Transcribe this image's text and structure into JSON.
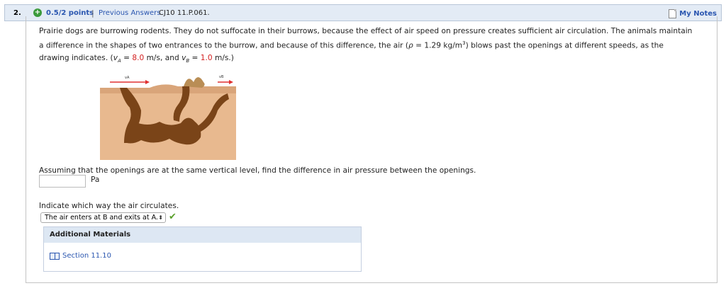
{
  "header": {
    "question_number": "2.",
    "points": "0.5/2 points",
    "separator": "|",
    "previous_answers": "Previous Answers",
    "question_id": "CJ10 11.P.061.",
    "my_notes": "My Notes"
  },
  "problem": {
    "p1_line1": "Prairie dogs are burrowing rodents. They do not suffocate in their burrows, because the effect of air speed on pressure creates sufficient air circulation. The animals maintain",
    "p1_line2a": "a difference in the shapes of two entrances to the burrow, and because of this difference, the air (",
    "rho": "ρ",
    "p1_line2b": " = 1.29 kg/m",
    "sup3": "3",
    "p1_line2c": ") blows past the openings at different speeds, as the",
    "p1_line3a": "drawing indicates. (",
    "va_label": "v",
    "va_sub": "A",
    "eq1": " = ",
    "va_value": "8.0",
    "va_unit": " m/s, and ",
    "vb_label": "v",
    "vb_sub": "B",
    "eq2": " = ",
    "vb_value": "1.0",
    "vb_unit": " m/s.)"
  },
  "figure": {
    "label_a": "vA",
    "label_b": "vB"
  },
  "part1": {
    "question": "Assuming that the openings are at the same vertical level, find the difference in air pressure between the openings.",
    "input_value": "",
    "unit": "Pa"
  },
  "part2": {
    "question": "Indicate which way the air circulates.",
    "selected": "The air enters at B and exits at A.",
    "arrow": "⬍"
  },
  "additional": {
    "title": "Additional Materials",
    "link": "Section 11.10"
  },
  "colors": {
    "link": "#2a56b0",
    "red": "#d42020",
    "correct": "#5aa02c"
  }
}
